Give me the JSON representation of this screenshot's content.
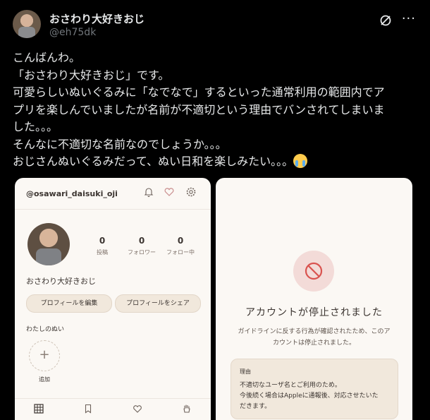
{
  "post": {
    "display_name": "おさわり大好きおじ",
    "handle": "@eh75dk",
    "text_lines": [
      "こんばんわ。",
      "「おさわり大好きおじ」です。",
      "可愛らしいぬいぐるみに「なでなで」するといった通常利用の範囲内でア",
      "プリを楽しんでいましたが名前が不適切という理由でバンされてしまいま",
      "した。。。",
      "そんなに不適切な名前なのでしょうか。。。",
      "おじさんぬいぐるみだって、ぬい日和を楽しみたい。。。"
    ],
    "emoji": "loudly-crying-face-emoji",
    "icons": {
      "grok": "grok-icon",
      "more": "more-options-icon"
    }
  },
  "left_screenshot": {
    "username": "@osawari_daisuki_oji",
    "header_icons": [
      "bell-icon",
      "heart-icon",
      "settings-icon"
    ],
    "stats": [
      {
        "num": "0",
        "label": "投稿"
      },
      {
        "num": "0",
        "label": "フォロワー"
      },
      {
        "num": "0",
        "label": "フォロー中"
      }
    ],
    "display_name": "おさわり大好きおじ",
    "buttons": {
      "edit": "プロフィールを編集",
      "share": "プロフィールをシェア"
    },
    "section_title": "わたしのぬい",
    "add_symbol": "+",
    "add_label": "追加",
    "nav_icons": [
      "grid-icon",
      "bookmark-icon",
      "heart-icon",
      "hand-icon"
    ]
  },
  "right_screenshot": {
    "icon": "prohibited-icon",
    "title": "アカウントが停止されました",
    "desc_line1": "ガイドラインに反する行為が確認されたため、このア",
    "desc_line2": "カウントは停止されました。",
    "reason_label": "理由",
    "reason_lines": [
      "不適切なユーザ名とご利用のため。",
      "今後続く場合はAppleに通報後、対応させたいた",
      "だきます。"
    ]
  },
  "colors": {
    "background": "#000000",
    "text": "#e7e9ea",
    "muted": "#71767b",
    "card": "#fbf8f4",
    "pill": "#f1e8dc",
    "ban_red": "#d9534f"
  }
}
